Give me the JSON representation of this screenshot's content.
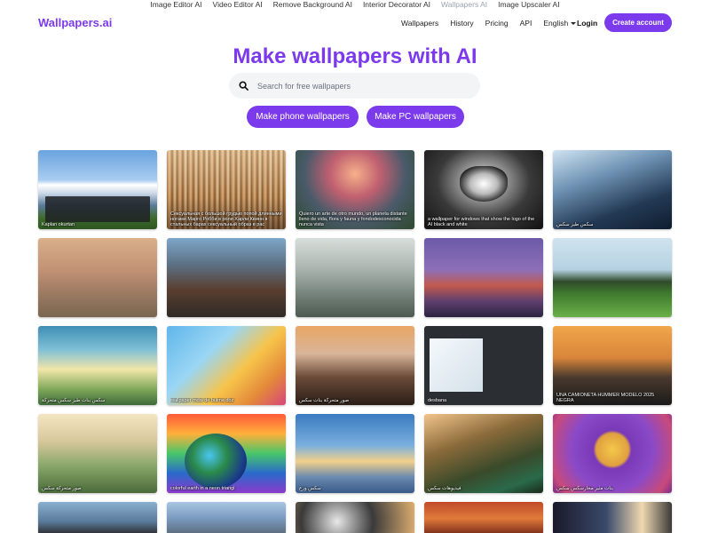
{
  "topbar": {
    "links": [
      "Image Editor AI",
      "Video Editor AI",
      "Remove Background AI",
      "Interior Decorator AI",
      "Wallpapers AI",
      "Image Upscaler AI"
    ],
    "active_index": 4
  },
  "header": {
    "logo": "Wallpapers.ai",
    "nav": {
      "wallpapers": "Wallpapers",
      "history": "History",
      "pricing": "Pricing",
      "api": "API",
      "language": "English"
    },
    "login": "Login",
    "create_account": "Create account"
  },
  "hero": {
    "title": "Make wallpapers with AI",
    "search_placeholder": "Search for free wallpapers",
    "phone_button": "Make phone wallpapers",
    "pc_button": "Make PC wallpapers"
  },
  "colors": {
    "brand": "#7c3aed",
    "search_bg": "#f3f4f6"
  },
  "gallery": [
    {
      "caption": "Kaplan okurtan"
    },
    {
      "caption": "Сексуальная с большой грудью попой длинными ногами Марго Робби в роли Харли Квинн в стальных барах сексуальный образ в рас"
    },
    {
      "caption": "Quiero un arte de otro mundo, un planeta distante lleno de vida, flora y fauna y fondodesconocida nunca vista"
    },
    {
      "caption": "a wallpaper for windows that show the logo of the AI black and white"
    },
    {
      "caption": "سكس طيز سكس"
    },
    {
      "caption": ""
    },
    {
      "caption": ""
    },
    {
      "caption": ""
    },
    {
      "caption": ""
    },
    {
      "caption": ""
    },
    {
      "caption": "سكس بنات طيز سكس متحركة"
    },
    {
      "caption": "wallpaper mdw de bulma dbz"
    },
    {
      "caption": "صور متحركة بنات سكس"
    },
    {
      "caption": "desbana"
    },
    {
      "caption": "UNA CAMIONETA HUMMER MODELO 2025 NEGRA"
    },
    {
      "caption": "صور متحركة سكس"
    },
    {
      "caption": "colorful earth in a neon triangl"
    },
    {
      "caption": "سكس ورع"
    },
    {
      "caption": "فيديوهات سكس"
    },
    {
      "caption": "بنات مثير مخارسكس سكس"
    },
    {
      "caption": ""
    },
    {
      "caption": ""
    },
    {
      "caption": ""
    },
    {
      "caption": ""
    },
    {
      "caption": ""
    }
  ]
}
